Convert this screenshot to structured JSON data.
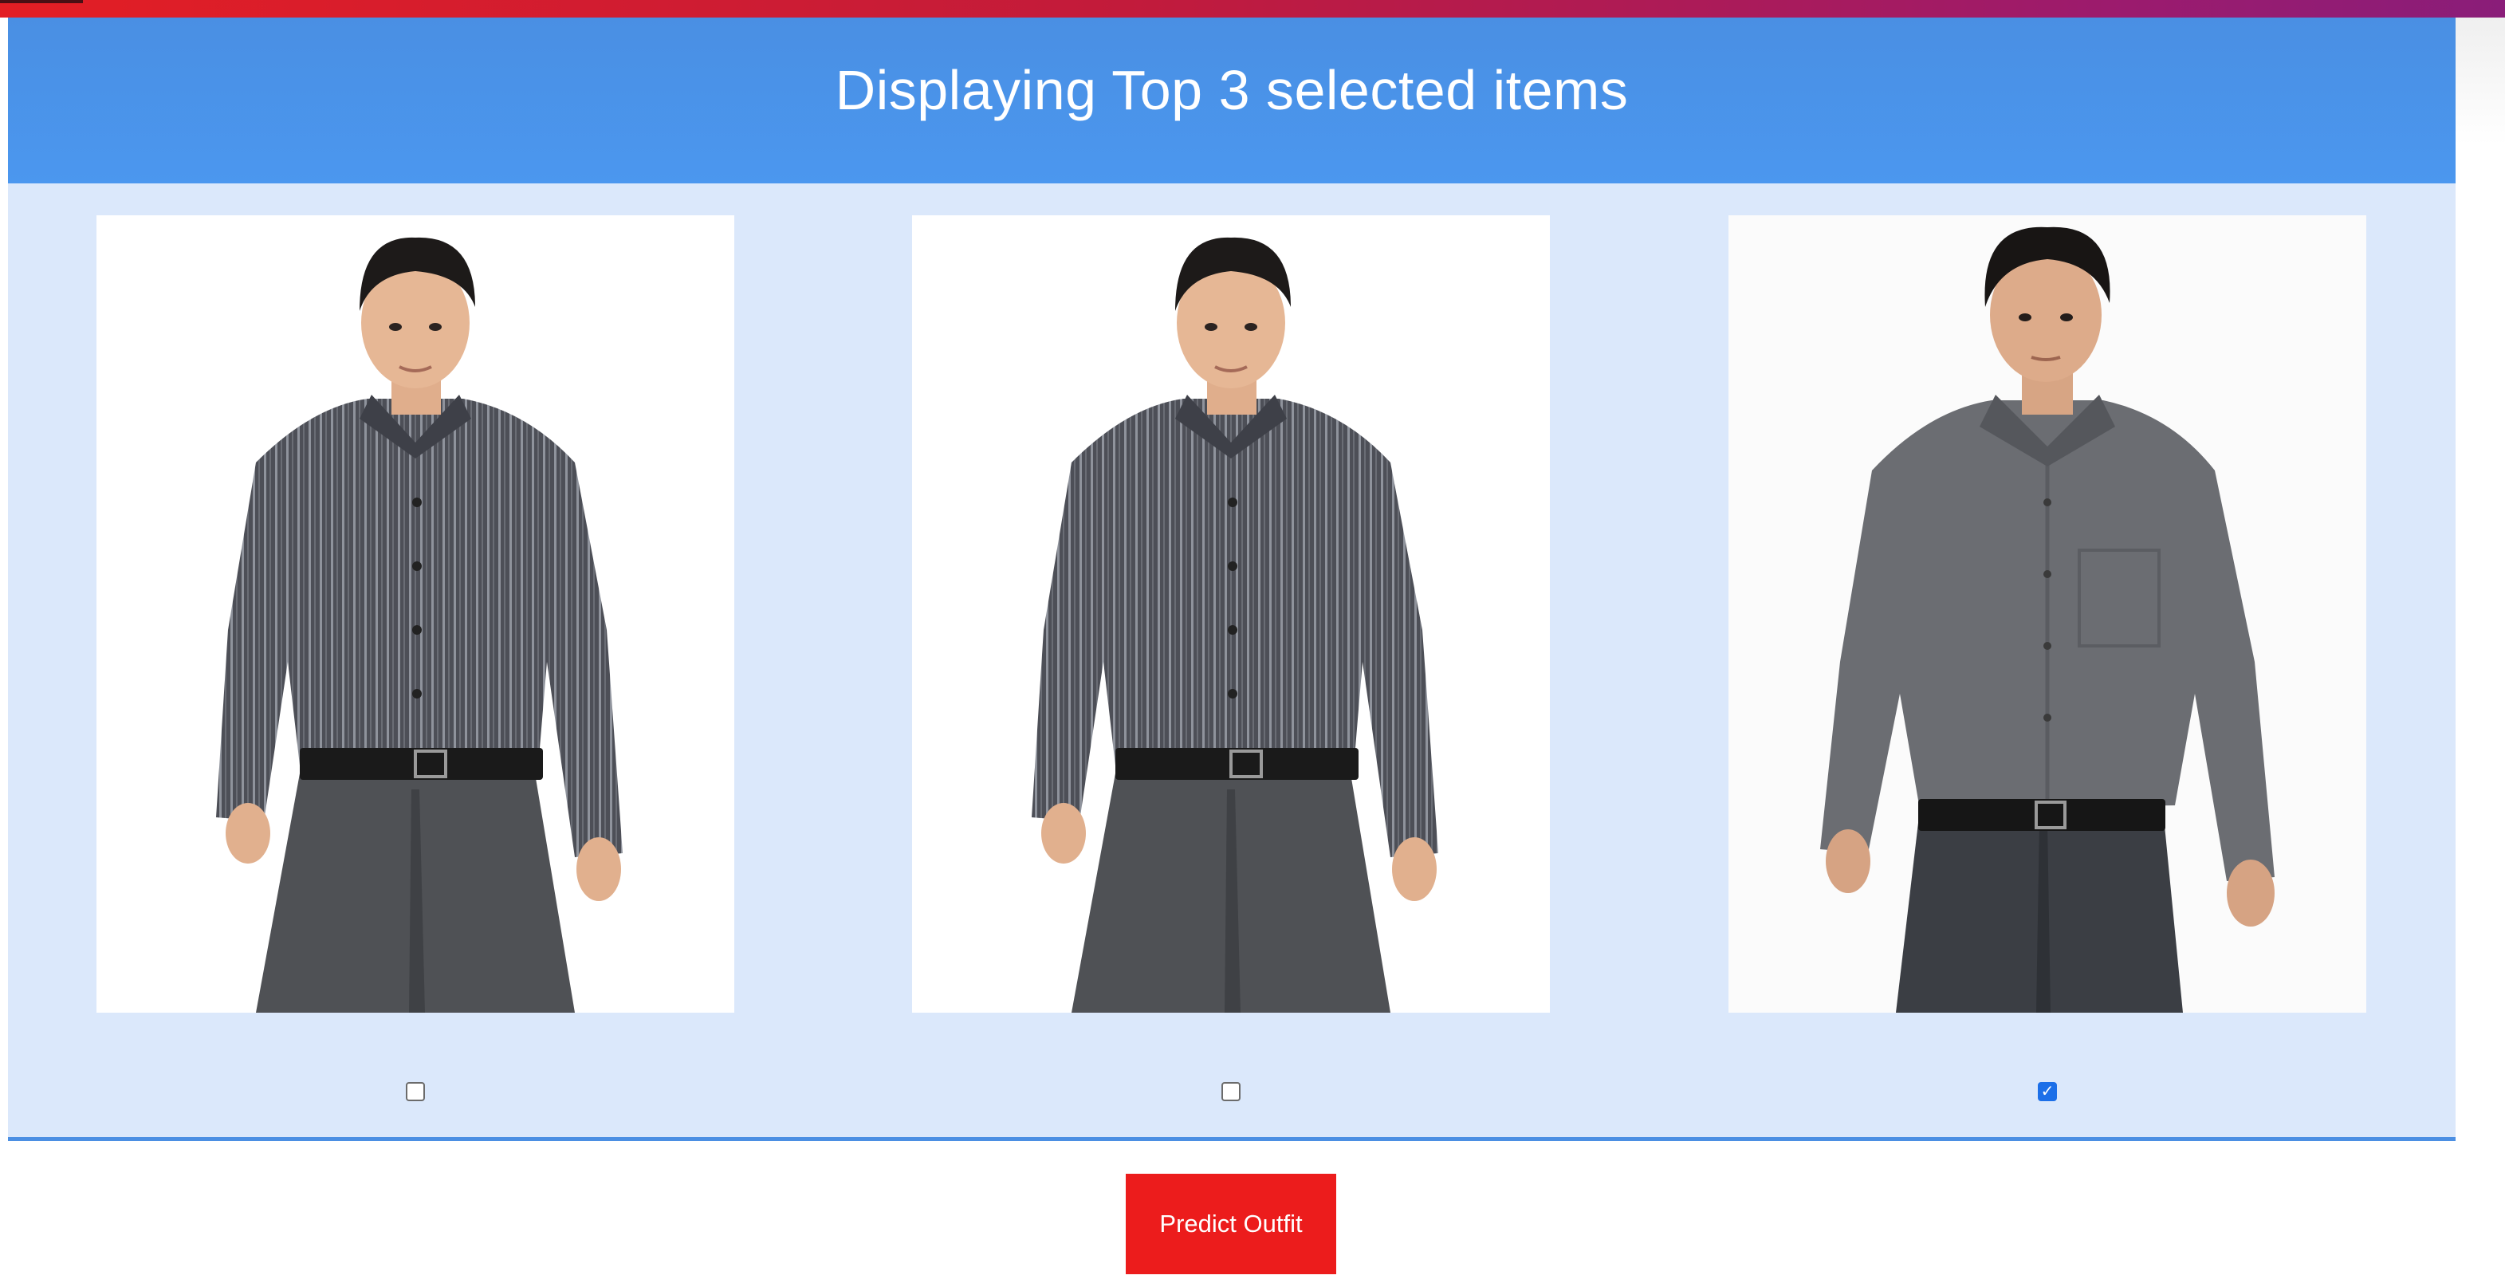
{
  "header": {
    "title": "Displaying Top 3 selected items"
  },
  "items": [
    {
      "image_name": "man-striped-shirt-photo",
      "checked": false
    },
    {
      "image_name": "man-striped-shirt-photo",
      "checked": false
    },
    {
      "image_name": "man-grey-shirt-photo",
      "checked": true
    }
  ],
  "actions": {
    "predict_label": "Predict Outfit"
  },
  "colors": {
    "header_blue": "#4b97ef",
    "panel_bg": "#dbe8fb",
    "button_red": "#ec1c1c",
    "checkbox_checked": "#1c6fe8"
  }
}
